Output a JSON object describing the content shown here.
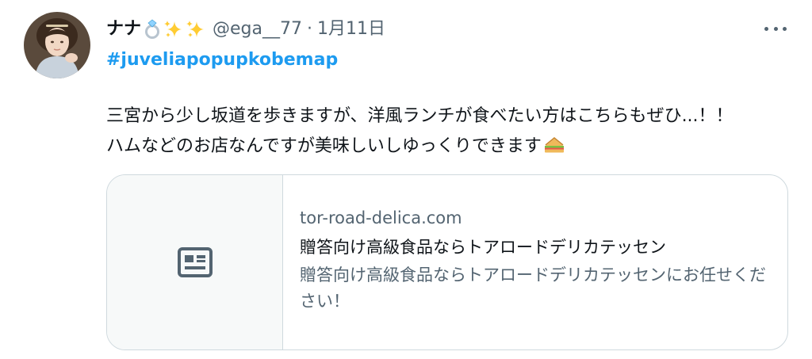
{
  "tweet": {
    "display_name": "ナナ",
    "name_emojis": [
      "ring-emoji",
      "sparkles-emoji",
      "sparkles-emoji"
    ],
    "handle": "@ega__77",
    "separator": "·",
    "date": "1月11日",
    "hashtag": "#juveliapopupkobemap",
    "text_lines": [
      "三宮から少し坂道を歩きますが、洋風ランチが食べたい方はこちらもぜひ...！！",
      "ハムなどのお店なんですが美味しいしゆっくりできます"
    ],
    "text_emoji": "sandwich-emoji",
    "more_icon": "more-options-icon"
  },
  "card": {
    "icon": "article-icon",
    "domain": "tor-road-delica.com",
    "title": "贈答向け高級食品ならトアロードデリカテッセン",
    "description": "贈答向け高級食品ならトアロードデリカテッセンにお任せください！"
  },
  "colors": {
    "link": "#1d9bf0",
    "secondary_text": "#536471",
    "primary_text": "#0f1419",
    "border": "#cfd9de",
    "card_media_bg": "#f7f9f9"
  }
}
